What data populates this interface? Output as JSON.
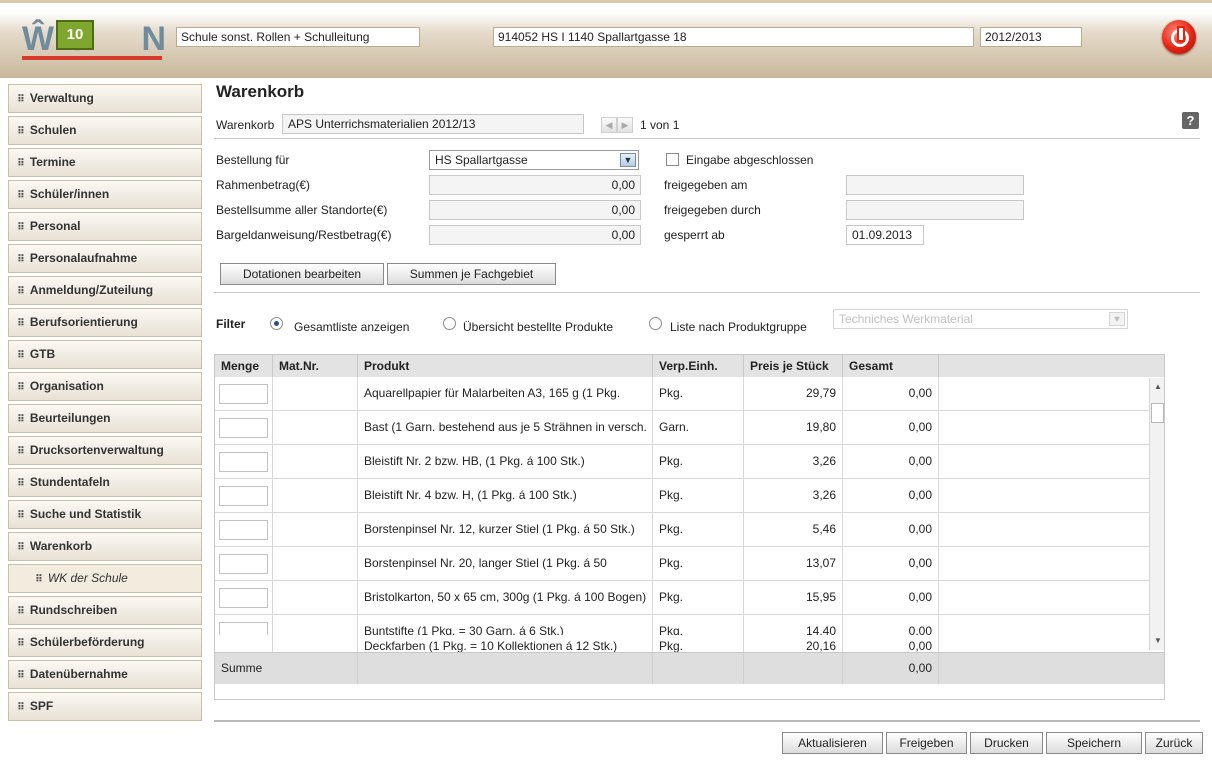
{
  "header": {
    "logo_text": "WSION",
    "role": "Schule sonst. Rollen + Schulleitung",
    "school": "914052 HS I 1140 Spallartgasse 18",
    "year": "2012/2013",
    "power_icon": "power-icon"
  },
  "sidebar": {
    "items": [
      {
        "label": "Verwaltung"
      },
      {
        "label": "Schulen"
      },
      {
        "label": "Termine"
      },
      {
        "label": "Schüler/innen"
      },
      {
        "label": "Personal"
      },
      {
        "label": "Personalaufnahme"
      },
      {
        "label": "Anmeldung/Zuteilung"
      },
      {
        "label": "Berufsorientierung"
      },
      {
        "label": "GTB"
      },
      {
        "label": "Organisation"
      },
      {
        "label": "Beurteilungen"
      },
      {
        "label": "Drucksortenverwaltung"
      },
      {
        "label": "Stundentafeln"
      },
      {
        "label": "Suche und Statistik"
      },
      {
        "label": "Warenkorb"
      },
      {
        "label": "WK der Schule"
      },
      {
        "label": "Rundschreiben"
      },
      {
        "label": "Schülerbeförderung"
      },
      {
        "label": "Datenübernahme"
      },
      {
        "label": "SPF"
      }
    ]
  },
  "main": {
    "title": "Warenkorb",
    "warenkorb_label": "Warenkorb",
    "warenkorb_value": "APS Unterrichsmaterialien 2012/13",
    "pager": "1 von 1",
    "help": "?",
    "form": {
      "bestellung_label": "Bestellung für",
      "bestellung_value": "HS Spallartgasse",
      "eingabe_label": "Eingabe abgeschlossen",
      "rahmen_label": "Rahmenbetrag(€)",
      "rahmen_value": "0,00",
      "bestellsumme_label": "Bestellsumme aller Standorte(€)",
      "bestellsumme_value": "0,00",
      "bargeld_label": "Bargeldanweisung/Restbetrag(€)",
      "bargeld_value": "0,00",
      "freigegeben_am_label": "freigegeben am",
      "freigegeben_am_value": "",
      "freigegeben_durch_label": "freigegeben durch",
      "freigegeben_durch_value": "",
      "gesperrt_label": "gesperrt ab",
      "gesperrt_value": "01.09.2013"
    },
    "buttons": {
      "dotationen": "Dotationen bearbeiten",
      "summen": "Summen je Fachgebiet"
    },
    "filter": {
      "label": "Filter",
      "opt1": "Gesamtliste anzeigen",
      "opt2": "Übersicht bestellte Produkte",
      "opt3": "Liste nach Produktgruppe",
      "group_value": "Techniches Werkmaterial"
    },
    "table": {
      "headers": [
        "Menge",
        "Mat.Nr.",
        "Produkt",
        "Verp.Einh.",
        "Preis je Stück",
        "Gesamt"
      ],
      "rows": [
        {
          "produkt": "Aquarellpapier für Malarbeiten A3, 165 g (1 Pkg.",
          "einheit": "Pkg.",
          "preis": "29,79",
          "gesamt": "0,00"
        },
        {
          "produkt": "Bast (1 Garn. bestehend aus je 5 Strähnen in versch.",
          "einheit": "Garn.",
          "preis": "19,80",
          "gesamt": "0,00"
        },
        {
          "produkt": "Bleistift Nr. 2 bzw. HB, (1 Pkg. á 100 Stk.)",
          "einheit": "Pkg.",
          "preis": "3,26",
          "gesamt": "0,00"
        },
        {
          "produkt": "Bleistift Nr. 4 bzw. H, (1 Pkg. á 100 Stk.)",
          "einheit": "Pkg.",
          "preis": "3,26",
          "gesamt": "0,00"
        },
        {
          "produkt": "Borstenpinsel Nr. 12, kurzer Stiel (1 Pkg. á 50 Stk.)",
          "einheit": "Pkg.",
          "preis": "5,46",
          "gesamt": "0,00"
        },
        {
          "produkt": "Borstenpinsel Nr. 20, langer Stiel (1 Pkg. á 50",
          "einheit": "Pkg.",
          "preis": "13,07",
          "gesamt": "0,00"
        },
        {
          "produkt": "Bristolkarton, 50 x 65 cm, 300g (1 Pkg. á 100 Bogen)",
          "einheit": "Pkg.",
          "preis": "15,95",
          "gesamt": "0,00"
        },
        {
          "produkt": "Buntstifte (1 Pkg. = 30 Garn. á 6 Stk.)",
          "einheit": "Pkg.",
          "preis": "14,40",
          "gesamt": "0,00"
        },
        {
          "produkt": "Deckfarben (1 Pkg. = 10 Kollektionen á 12 Stk.)",
          "einheit": "Pkg.",
          "preis": "20,16",
          "gesamt": "0,00"
        }
      ],
      "sum_label": "Summe",
      "sum_value": "0,00"
    },
    "footer_buttons": {
      "aktualisieren": "Aktualisieren",
      "freigeben": "Freigeben",
      "drucken": "Drucken",
      "speichern": "Speichern",
      "zurueck": "Zurück"
    }
  }
}
